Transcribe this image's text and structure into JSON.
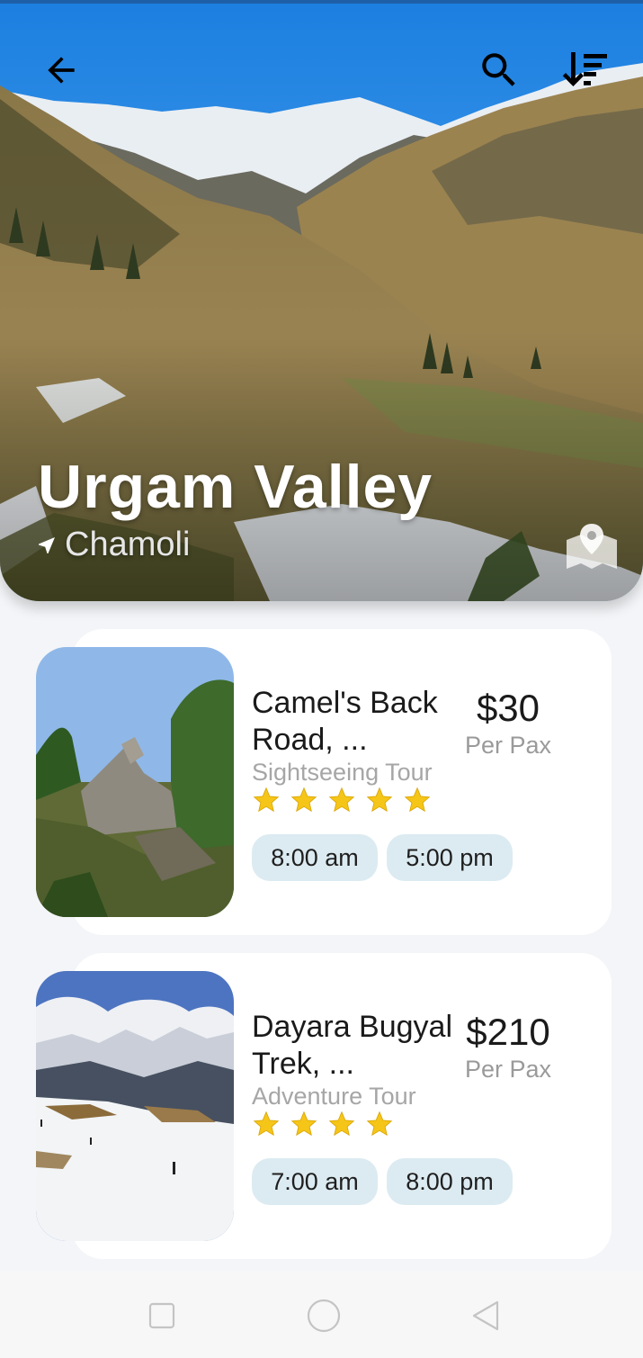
{
  "hero": {
    "title": "Urgam Valley",
    "location": "Chamoli"
  },
  "icons": {
    "back": "arrow-back-icon",
    "search": "search-icon",
    "sort": "sort-icon",
    "location": "navigation-arrow-icon",
    "map": "map-pin-icon",
    "star": "star-icon"
  },
  "tours": [
    {
      "title_line1": "Camel's Back",
      "title_line2": "Road, ...",
      "type": "Sightseeing Tour",
      "price": "$30",
      "unit": "Per Pax",
      "rating": 5,
      "times": [
        "8:00 am",
        "5:00 pm"
      ]
    },
    {
      "title_line1": "Dayara Bugyal",
      "title_line2": "Trek, ...",
      "type": "Adventure Tour",
      "price": "$210",
      "unit": "Per Pax",
      "rating": 4,
      "times": [
        "7:00 am",
        "8:00 pm"
      ]
    }
  ],
  "colors": {
    "accent_chip": "#dcebf1",
    "star": "#f5c518",
    "page_bg": "#f3f5f8"
  },
  "system_nav": {
    "recents": "square-icon",
    "home": "circle-icon",
    "back": "triangle-back-icon"
  }
}
